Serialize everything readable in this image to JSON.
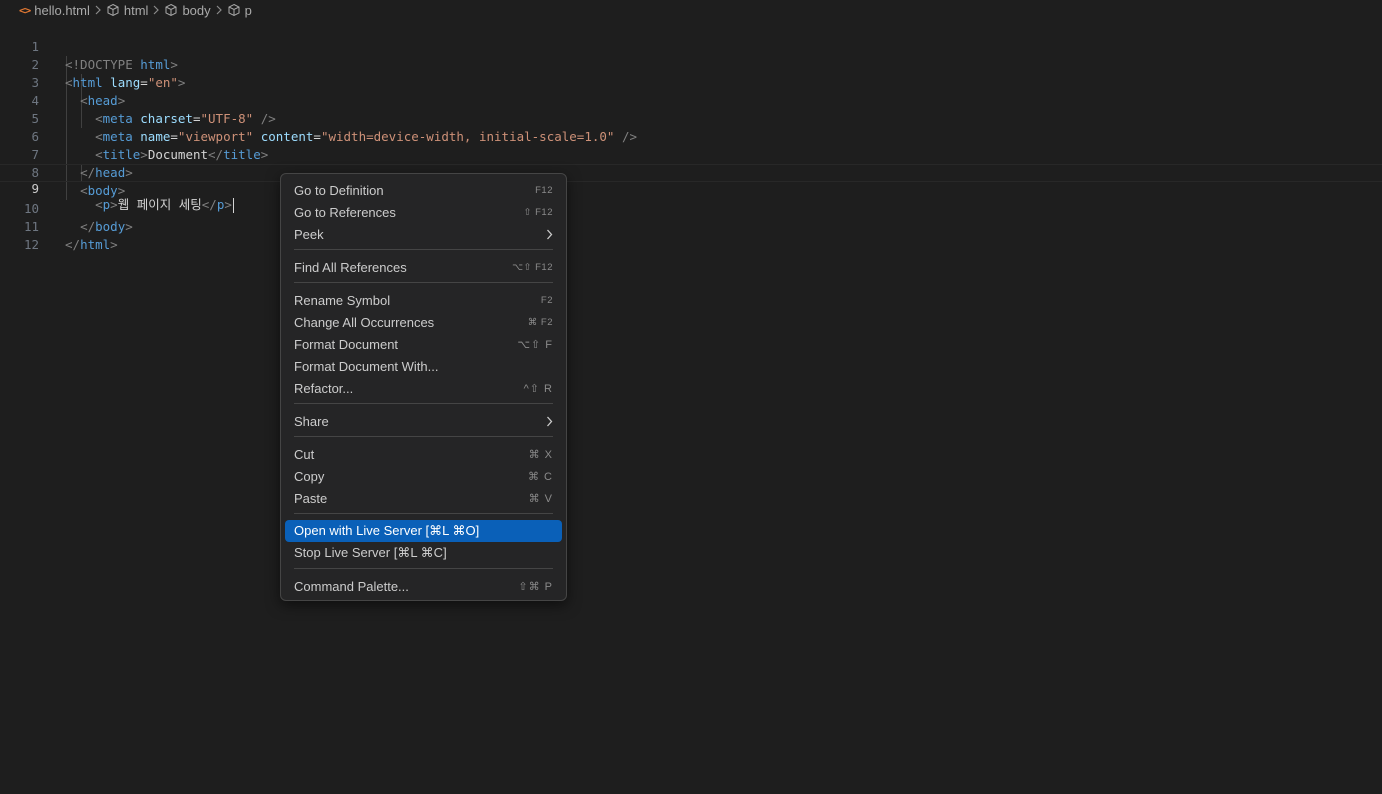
{
  "breadcrumb": {
    "file": "hello.html",
    "items": [
      "html",
      "body",
      "p"
    ]
  },
  "editor": {
    "current_line": 9,
    "line_numbers": [
      "1",
      "2",
      "3",
      "4",
      "5",
      "6",
      "7",
      "8",
      "9",
      "10",
      "11",
      "12"
    ],
    "lines": {
      "l1": {
        "open": "<!DOCTYPE ",
        "keyword": "html",
        "close": ">"
      },
      "l2": {
        "open": "<",
        "tag": "html",
        "attr": "lang",
        "eq": "=",
        "value": "\"en\"",
        "close": ">"
      },
      "l3": {
        "open": "<",
        "tag": "head",
        "close": ">"
      },
      "l4": {
        "open": "<",
        "tag": "meta",
        "attr": "charset",
        "eq": "=",
        "value": "\"UTF-8\"",
        "close": " />"
      },
      "l5": {
        "open": "<",
        "tag": "meta",
        "attr1": "name",
        "eq1": "=",
        "value1": "\"viewport\"",
        "attr2": "content",
        "eq2": "=",
        "value2": "\"width=device-width, initial-scale=1.0\"",
        "close": " />"
      },
      "l6": {
        "open": "<",
        "tag": "title",
        "close": ">",
        "text": "Document",
        "end_open": "</",
        "end_tag": "title",
        "end_close": ">"
      },
      "l7": {
        "open": "</",
        "tag": "head",
        "close": ">"
      },
      "l8": {
        "open": "<",
        "tag": "body",
        "close": ">"
      },
      "l9": {
        "open": "<",
        "tag": "p",
        "close": ">",
        "text": "웹 페이지 세팅",
        "end_open": "</",
        "end_tag": "p",
        "end_close": ">"
      },
      "l10": {
        "open": "</",
        "tag": "body",
        "close": ">"
      },
      "l11": {
        "open": "</",
        "tag": "html",
        "close": ">"
      }
    }
  },
  "context_menu": {
    "items": [
      {
        "label": "Go to Definition",
        "shortcut": "F12"
      },
      {
        "label": "Go to References",
        "shortcut": "⇧ F12"
      },
      {
        "label": "Peek",
        "submenu": true
      },
      {
        "label": "Find All References",
        "shortcut": "⌥⇧ F12"
      },
      {
        "label": "Rename Symbol",
        "shortcut": "F2"
      },
      {
        "label": "Change All Occurrences",
        "shortcut": "⌘ F2"
      },
      {
        "label": "Format Document",
        "shortcut": "⌥⇧ F"
      },
      {
        "label": "Format Document With...",
        "shortcut": ""
      },
      {
        "label": "Refactor...",
        "shortcut": "^⇧ R"
      },
      {
        "label": "Share",
        "submenu": true
      },
      {
        "label": "Cut",
        "shortcut": "⌘ X"
      },
      {
        "label": "Copy",
        "shortcut": "⌘ C"
      },
      {
        "label": "Paste",
        "shortcut": "⌘ V"
      },
      {
        "label": "Open with Live Server [⌘L ⌘O]",
        "shortcut": "",
        "highlighted": true
      },
      {
        "label": "Stop Live Server [⌘L ⌘C]",
        "shortcut": ""
      },
      {
        "label": "Command Palette...",
        "shortcut": "⇧⌘ P"
      }
    ]
  },
  "colors": {
    "editor_bg": "#1e1e1e",
    "menu_bg": "#252526",
    "highlight": "#0a60b8",
    "tag": "#569cd6",
    "attribute": "#9cdcfe",
    "string": "#ce9178",
    "file_icon": "#e37933"
  }
}
